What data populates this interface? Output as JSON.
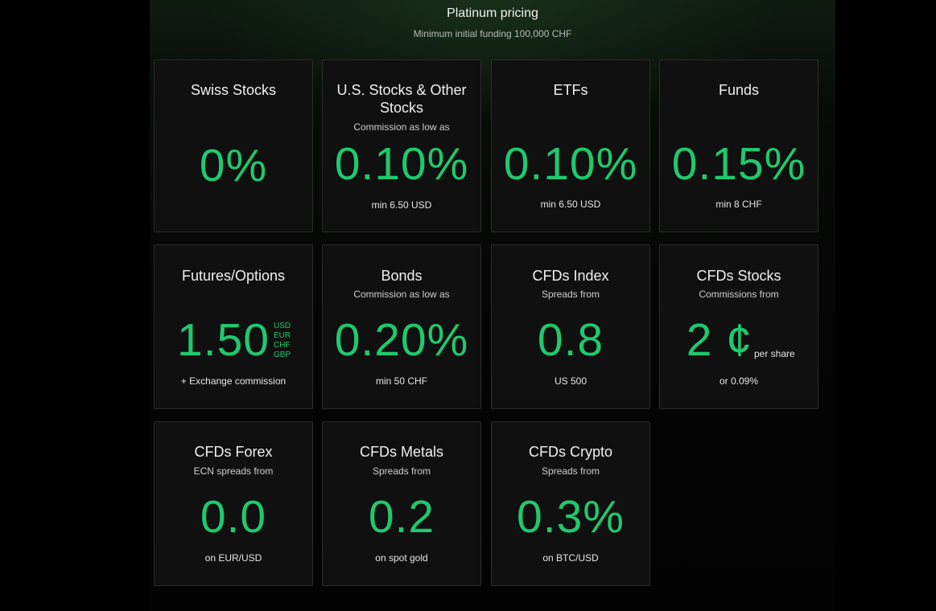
{
  "header": {
    "title": "Platinum pricing",
    "subtitle": "Minimum initial funding 100,000 CHF"
  },
  "cards": [
    {
      "title": "Swiss Stocks",
      "subtitle": "",
      "value": "0%",
      "note": ""
    },
    {
      "title": "U.S. Stocks & Other Stocks",
      "subtitle": "Commission as low as",
      "value": "0.10%",
      "note": "min 6.50 USD"
    },
    {
      "title": "ETFs",
      "subtitle": "",
      "value": "0.10%",
      "note": "min 6.50 USD"
    },
    {
      "title": "Funds",
      "subtitle": "",
      "value": "0.15%",
      "note": "min 8 CHF"
    },
    {
      "title": "Futures/Options",
      "subtitle": "",
      "value": "1.50",
      "currencies": [
        "USD",
        "EUR",
        "CHF",
        "GBP"
      ],
      "note": "+ Exchange commission"
    },
    {
      "title": "Bonds",
      "subtitle": "Commission as low as",
      "value": "0.20%",
      "note": "min 50 CHF"
    },
    {
      "title": "CFDs Index",
      "subtitle": "Spreads from",
      "value": "0.8",
      "note": "US 500"
    },
    {
      "title": "CFDs Stocks",
      "subtitle": "Commissions from",
      "value": "2 ¢",
      "unit": "per share",
      "note": "or 0.09%"
    },
    {
      "title": "CFDs Forex",
      "subtitle": "ECN spreads from",
      "value": "0.0",
      "note": "on EUR/USD"
    },
    {
      "title": "CFDs Metals",
      "subtitle": "Spreads from",
      "value": "0.2",
      "note": "on spot gold"
    },
    {
      "title": "CFDs Crypto",
      "subtitle": "Spreads from",
      "value": "0.3%",
      "note": "on BTC/USD"
    }
  ],
  "colors": {
    "accent": "#1fc96e",
    "card_bg": "#101010",
    "card_border": "#2c2c2c",
    "page_bg": "#000000"
  }
}
